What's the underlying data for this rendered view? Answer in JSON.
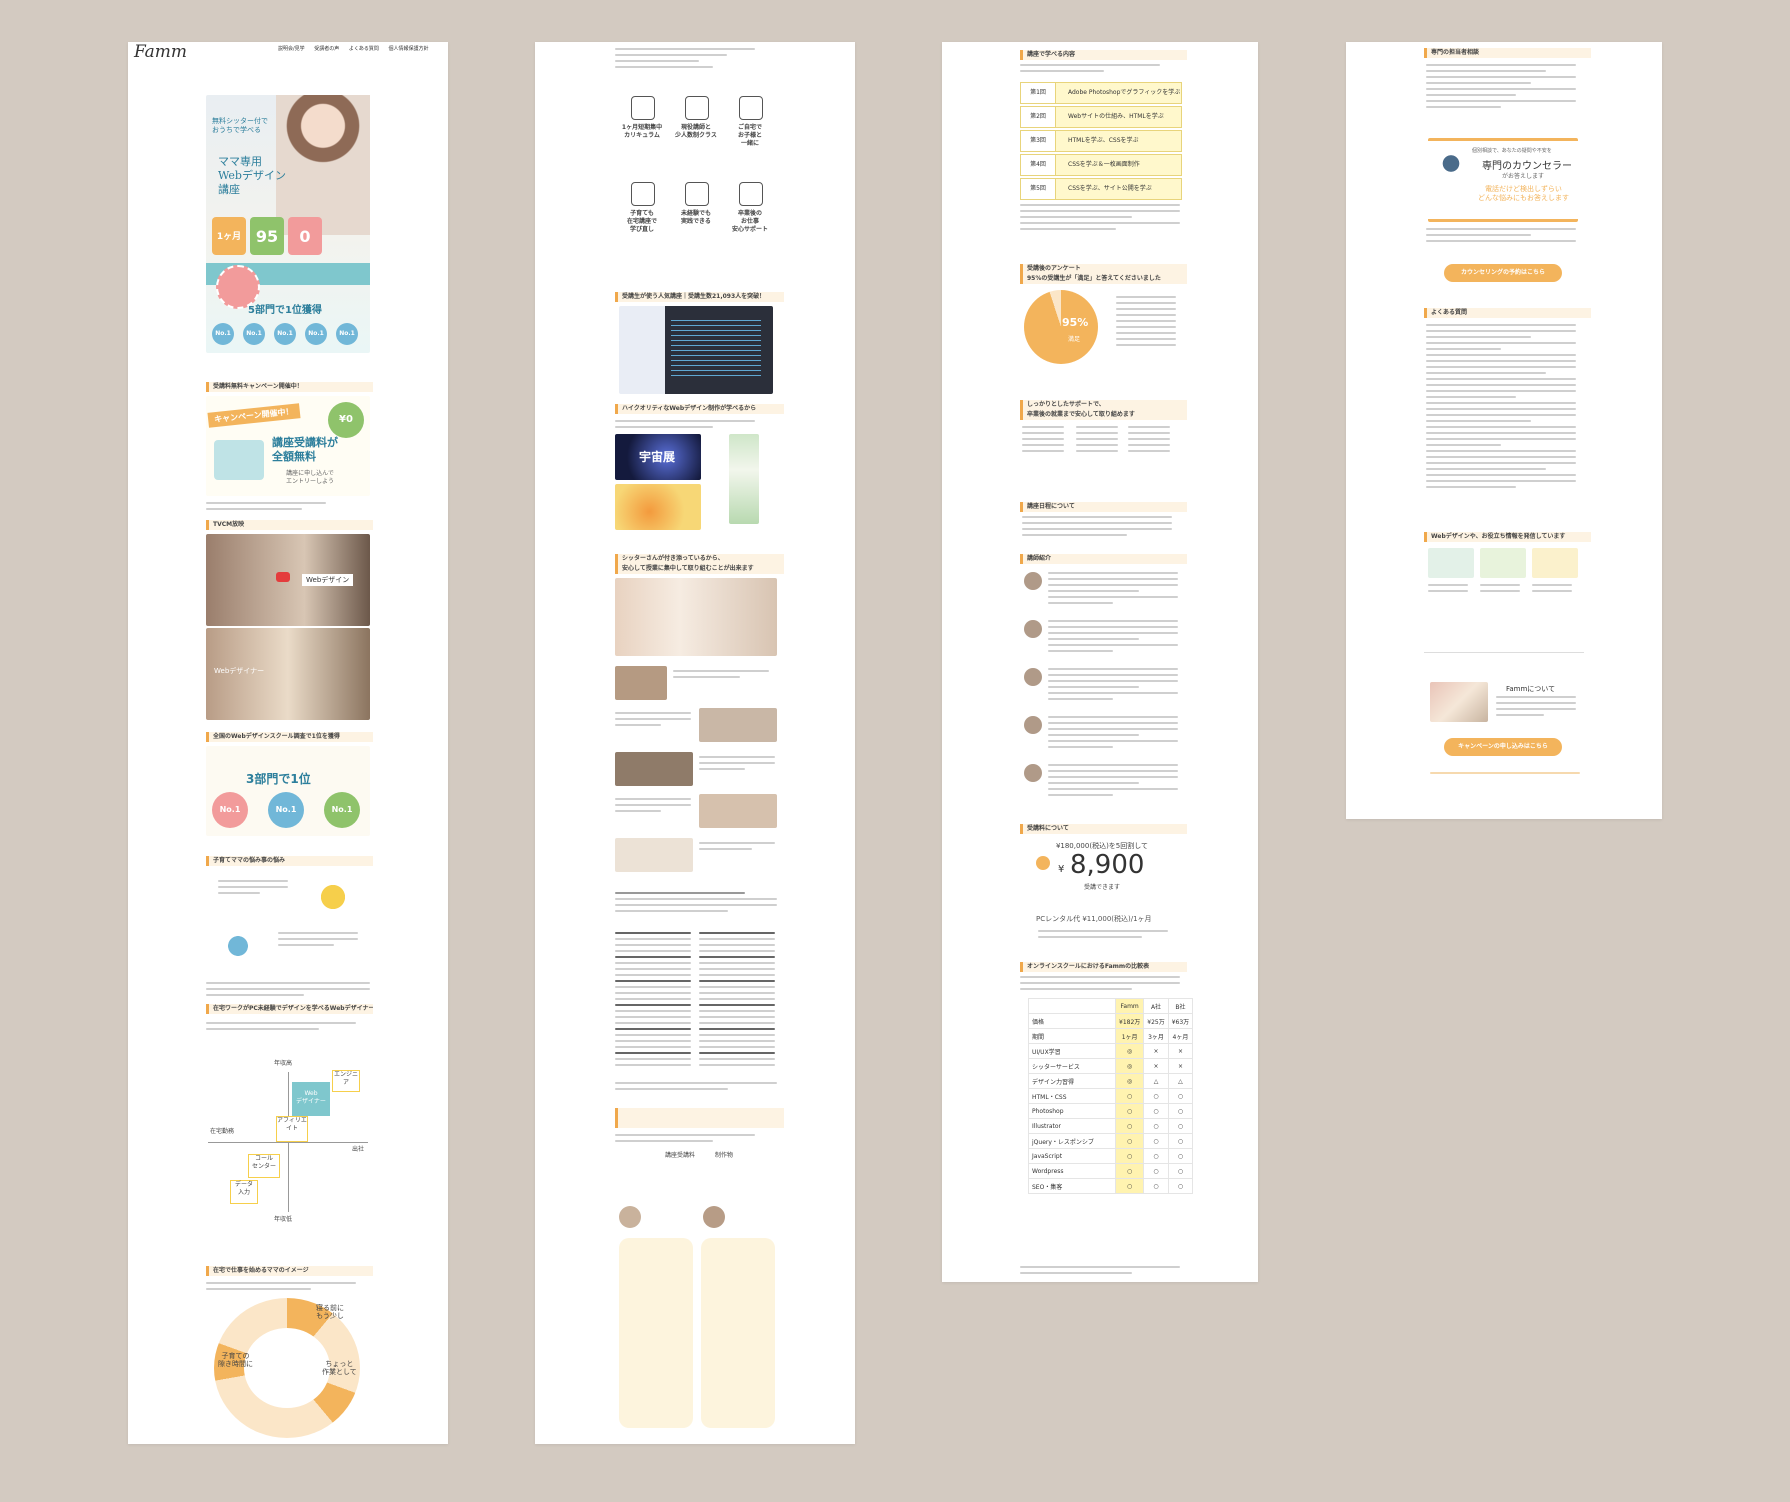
{
  "colors": {
    "background": "#d3cac1",
    "accent_orange": "#f3b45c",
    "accent_yellow": "#f6cf4b",
    "teal": "#2d7f9c",
    "green": "#8fc36b",
    "pink": "#f29b9b",
    "blue": "#71b7d8",
    "famm_column": "#fff3b0"
  },
  "page1": {
    "logo": "Famm",
    "nav": [
      "説明会/見学",
      "受講者の声",
      "よくある質問",
      "個人情報保護方針"
    ],
    "hero": {
      "tagline": "無料シッター付で\nおうちで学べる",
      "title": "ママ専用\nWebデザイン\n講座",
      "stat1": "1ヶ月",
      "stat2": "95",
      "stat3": "0",
      "rank": "5部門で1位獲得",
      "no1": "No.1"
    },
    "campaign": {
      "heading": "受講料無料キャンペーン開催中！",
      "ribbon": "キャンペーン開催中！",
      "price_badge": "¥0",
      "title": "講座受講料が\n全額無料",
      "sub": "講座に申し込んで\nエントリーしよう"
    },
    "video": {
      "heading": "TVCM放映",
      "caption1": "Webデザイン",
      "caption2": "Webデザイナー"
    },
    "ranking": {
      "heading": "全国のWebデザインスクール調査で1位を獲得",
      "title": "3部門で1位",
      "no1": "No.1"
    },
    "mama": {
      "heading": "子育てママの悩み事の悩み"
    },
    "career": {
      "heading": "在宅ワークがPC未経験でデザインを学べるWebデザイナー",
      "top": "年収高",
      "bottom": "年収低",
      "left": "在宅勤務",
      "right": "出社",
      "box_main": "Web\nデザイナー",
      "box_engineer": "エンジニア",
      "box_affiliate": "アフィリエイト",
      "box_callcenter": "コール\nセンター",
      "box_data": "データ\n入力"
    },
    "donut": {
      "heading": "在宅で仕事を始めるママのイメージ",
      "label1": "子育ての\n隙き時間に",
      "label2": "寝る前に\nもう少し",
      "label3": "ちょっと\n作業として"
    }
  },
  "page2": {
    "features": [
      {
        "icon": "calendar-icon",
        "label": "1ヶ月短期集中\nカリキュラム"
      },
      {
        "icon": "teacher-icon",
        "label": "現役講師と\n少人数制クラス"
      },
      {
        "icon": "baby-icon",
        "label": "ご自宅で\nお子様と\n一緒に"
      },
      {
        "icon": "pc-icon",
        "label": "子育ても\n在宅講座で\n学び直し"
      },
      {
        "icon": "camera-icon",
        "label": "未経験でも\n実践できる"
      },
      {
        "icon": "person-icon",
        "label": "卒業後の\nお仕事\n安心サポート"
      }
    ],
    "screenshot_heading": "受講生が使う人気講座｜受講生数21,093人を突破！",
    "works_heading": "ハイクオリティなWebデザイン制作が学べるから",
    "works_title": "宇宙展",
    "sitter_heading": "シッターさんが付き添っているから、\n安心して授業に集中して取り組むことが出来ます",
    "fee_item1": "講座受講料",
    "fee_item2": "制作物"
  },
  "page3": {
    "sched_heading": "講座で学べる内容",
    "schedule": [
      {
        "k": "第1回",
        "v": "Adobe Photoshopでグラフィックを学ぶ"
      },
      {
        "k": "第2回",
        "v": "Webサイトの仕組み、HTMLを学ぶ"
      },
      {
        "k": "第3回",
        "v": "HTMLを学ぶ、CSSを学ぶ"
      },
      {
        "k": "第4回",
        "v": "CSSを学ぶ＆一枚画面制作"
      },
      {
        "k": "第5回",
        "v": "CSSを学ぶ、サイト公開を学ぶ"
      }
    ],
    "survey_heading": "受講後のアンケート\n95%の受講生が「満足」と答えてくださいました",
    "survey_value": "95%",
    "survey_label": "満足",
    "support_heading": "しっかりとしたサポートで、\n卒業後の就業まで安心して取り組めます",
    "schedule_info_heading": "講座日程について",
    "teacher_heading": "講師紹介",
    "fee_heading": "受講料について",
    "fee_prefix": "¥180,000(税込)を5回割して",
    "fee_value": "8,900",
    "fee_yen": "¥",
    "fee_suffix": "受講できます",
    "rental": "PCレンタル代 ¥11,000(税込)/1ヶ月",
    "compare_heading": "オンラインスクールにおけるFammの比較表",
    "compare_cols": [
      "Famm",
      "A社",
      "B社"
    ],
    "compare_rows": [
      {
        "label": "価格",
        "famm": "¥182万",
        "a": "¥25万",
        "b": "¥63万"
      },
      {
        "label": "期間",
        "famm": "1ヶ月",
        "a": "3ヶ月",
        "b": "4ヶ月"
      },
      {
        "label": "UI/UX学習",
        "famm": "◎",
        "a": "×",
        "b": "×"
      },
      {
        "label": "シッターサービス",
        "famm": "◎",
        "a": "×",
        "b": "×"
      },
      {
        "label": "デザイン力習得",
        "famm": "◎",
        "a": "△",
        "b": "△"
      },
      {
        "label": "HTML・CSS",
        "famm": "○",
        "a": "○",
        "b": "○"
      },
      {
        "label": "Photoshop",
        "famm": "○",
        "a": "○",
        "b": "○"
      },
      {
        "label": "Illustrator",
        "famm": "○",
        "a": "○",
        "b": "○"
      },
      {
        "label": "jQuery・レスポンシブ",
        "famm": "○",
        "a": "○",
        "b": "○"
      },
      {
        "label": "JavaScript",
        "famm": "○",
        "a": "○",
        "b": "○"
      },
      {
        "label": "Wordpress",
        "famm": "○",
        "a": "○",
        "b": "○"
      },
      {
        "label": "SEO・集客",
        "famm": "○",
        "a": "○",
        "b": "○"
      }
    ]
  },
  "page4": {
    "heading1": "専門の担当者相談",
    "counselor_lead": "個別相談で、あなたの疑問や不安を",
    "counselor_title": "専門のカウンセラー",
    "counselor_sub": "がお答えします",
    "counselor_note": "電話だけど検出しずらい\nどんな悩みにもお答えします",
    "button1": "カウンセリングの予約はこちら",
    "faq_heading": "よくある質問",
    "blog_heading": "Webデザインや、お役立ち情報を発信しています",
    "about_title": "Fammについて",
    "button2": "キャンペーンの申し込みはこちら"
  }
}
